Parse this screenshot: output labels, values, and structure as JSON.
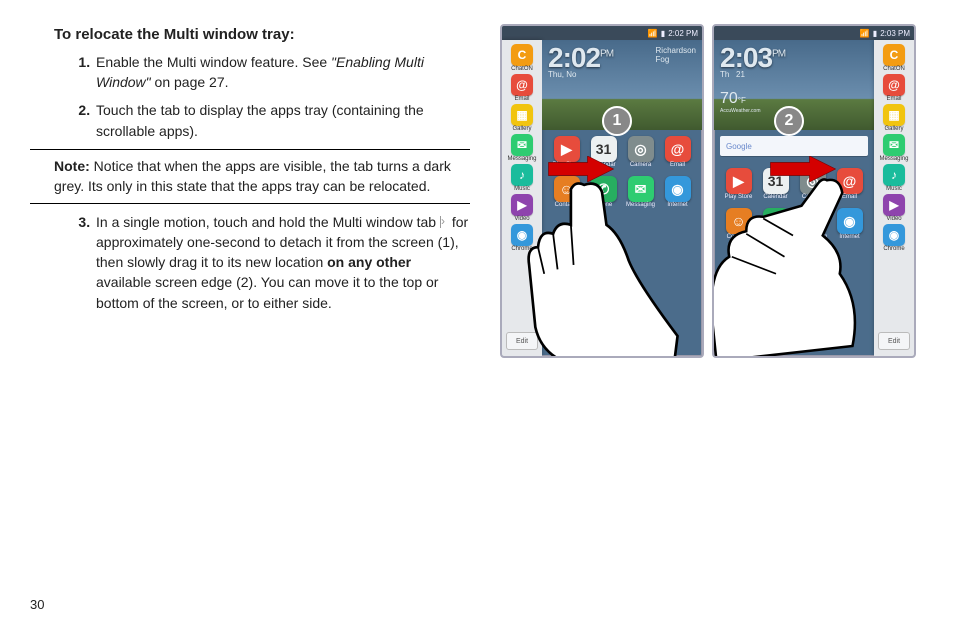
{
  "heading": "To relocate the Multi window tray:",
  "steps": {
    "s1_a": "Enable the Multi window feature. See ",
    "s1_ital": "\"Enabling Multi Window\"",
    "s1_b": " on page 27.",
    "s2": "Touch the tab to display the apps tray (containing the scrollable apps).",
    "s3_a": "In a single motion, touch and hold the Multi window tab ",
    "s3_b": " for approximately one-second to detach it from the screen (1), then slowly drag it to its new location ",
    "s3_bold": "on any other",
    "s3_c": " available screen edge (2). You can move it to the top or bottom of the screen, or to either side."
  },
  "note": {
    "label": "Note:",
    "body": " Notice that when the apps are visible, the tab turns a dark grey. Its only in this state that the apps tray can be relocated."
  },
  "page_number": "30",
  "phone1": {
    "status_time": "2:02 PM",
    "clock": "2:02",
    "ampm": "PM",
    "date": "Thu, No",
    "weather_loc": "Richardson",
    "weather_cond": "Fog",
    "callout": "1"
  },
  "phone2": {
    "status_time": "2:03 PM",
    "clock": "2:03",
    "ampm": "PM",
    "date": "Th",
    "weather_day": "21",
    "temp": "70",
    "temp_unit": "°F",
    "weather_sub": "AccuWeather.com",
    "search_placeholder": "Google",
    "callout": "2"
  },
  "tray": [
    {
      "label": "ChatON",
      "bg": "#f39c12",
      "glyph": "C"
    },
    {
      "label": "Email",
      "bg": "#e74c3c",
      "glyph": "@"
    },
    {
      "label": "Gallery",
      "bg": "#f1c40f",
      "glyph": "▦"
    },
    {
      "label": "Messaging",
      "bg": "#2ecc71",
      "glyph": "✉"
    },
    {
      "label": "Music",
      "bg": "#1abc9c",
      "glyph": "♪"
    },
    {
      "label": "Video",
      "bg": "#8e44ad",
      "glyph": "▶"
    },
    {
      "label": "Chrome",
      "bg": "#3498db",
      "glyph": "◉"
    }
  ],
  "edit_label": "Edit",
  "home_apps": [
    {
      "label": "Play Store",
      "bg": "#e74c3c",
      "glyph": "▶"
    },
    {
      "label": "Calendar",
      "bg": "#ecf0f1",
      "glyph": "31",
      "fg": "#333"
    },
    {
      "label": "Camera",
      "bg": "#7f8c8d",
      "glyph": "◎"
    },
    {
      "label": "Email",
      "bg": "#e74c3c",
      "glyph": "@"
    },
    {
      "label": "Contacts",
      "bg": "#e67e22",
      "glyph": "☺"
    },
    {
      "label": "Phone",
      "bg": "#27ae60",
      "glyph": "✆"
    },
    {
      "label": "Messaging",
      "bg": "#2ecc71",
      "glyph": "✉"
    },
    {
      "label": "Internet",
      "bg": "#3498db",
      "glyph": "◉"
    }
  ]
}
